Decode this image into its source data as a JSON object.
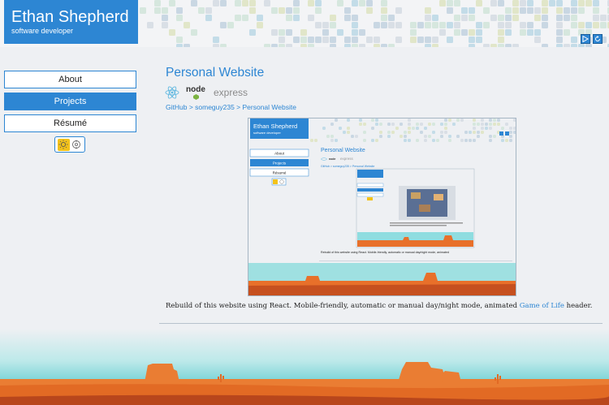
{
  "header": {
    "name": "Ethan Shepherd",
    "role": "software developer",
    "buttons": [
      {
        "icon": "play-icon"
      },
      {
        "icon": "reset-icon"
      }
    ]
  },
  "nav": {
    "items": [
      {
        "label": "About",
        "active": false
      },
      {
        "label": "Projects",
        "active": true
      },
      {
        "label": "Résumé",
        "active": false
      }
    ],
    "theme_toggle": {
      "options": [
        "sun-icon",
        "auto-icon"
      ],
      "selected": "sun-icon"
    }
  },
  "project": {
    "title": "Personal Website",
    "tech": [
      {
        "icon": "react-icon",
        "label": ""
      },
      {
        "icon": "nodejs-icon",
        "label": "node"
      },
      {
        "icon": "express-icon",
        "label": "express"
      }
    ],
    "breadcrumb": "GitHub > someguy235 > Personal Website",
    "description_before": "Rebuild of this website using React. Mobile-friendly, automatic or manual day/night mode, animated ",
    "description_link": "Game of Life",
    "description_after": " header."
  },
  "colors": {
    "accent": "#2d86d3",
    "background": "#eef0f3",
    "sun": "#f3c21a",
    "sky": "#7fd8dc",
    "desert": "#e8702a"
  }
}
